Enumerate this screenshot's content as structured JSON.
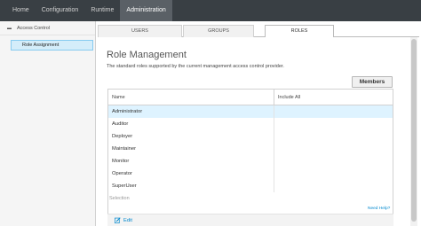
{
  "topnav": {
    "items": [
      "Home",
      "Configuration",
      "Runtime",
      "Administration"
    ],
    "active": "Administration"
  },
  "sidebar": {
    "group_label": "Access Control",
    "item_label": "Role Assignment"
  },
  "tabs": [
    "USERS",
    "GROUPS",
    "ROLES"
  ],
  "main": {
    "title": "Role Management",
    "description": "The standard roles supported by the current management access control provider.",
    "members_button": "Members",
    "table": {
      "columns": [
        "Name",
        "Include All"
      ],
      "rows": [
        {
          "name": "Administrator",
          "include_all": ""
        },
        {
          "name": "Auditor",
          "include_all": ""
        },
        {
          "name": "Deployer",
          "include_all": ""
        },
        {
          "name": "Maintainer",
          "include_all": ""
        },
        {
          "name": "Monitor",
          "include_all": ""
        },
        {
          "name": "Operator",
          "include_all": ""
        },
        {
          "name": "SuperUser",
          "include_all": ""
        }
      ],
      "selected_row": "Administrator"
    },
    "selection_label": "Selection",
    "need_help": "Need Help?",
    "edit_label": "Edit"
  },
  "colors": {
    "topbar": "#393f44",
    "active_nav": "#5a6066",
    "selection": "#d4edfa",
    "link": "#0088ce"
  }
}
